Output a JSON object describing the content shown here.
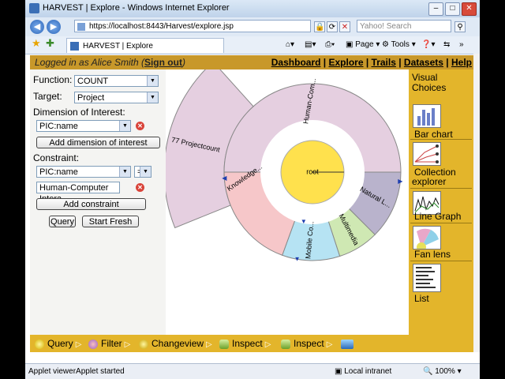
{
  "window": {
    "title": "HARVEST | Explore - Windows Internet Explorer"
  },
  "address_bar": {
    "url": "https://localhost:8443/Harvest/explore.jsp",
    "search_placeholder": "Yahoo! Search"
  },
  "tab": {
    "label": "HARVEST | Explore"
  },
  "ie_toolbar": {
    "page": "Page",
    "tools": "Tools"
  },
  "header": {
    "logged_prefix": "Logged in as Alice Smith (",
    "sign_out": "Sign out",
    "logged_suffix": ")",
    "links": [
      "Dashboard",
      "Explore",
      "Trails",
      "Datasets",
      "Help"
    ]
  },
  "form": {
    "function_label": "Function:",
    "function_value": "COUNT",
    "target_label": "Target:",
    "target_value": "Project",
    "dim_label": "Dimension of Interest:",
    "dim_value": "PIC:name",
    "add_dim": "Add dimension of interest",
    "constraint_label": "Constraint:",
    "constraint_field": "PIC:name",
    "constraint_op": "=",
    "constraint_value": "Human-Computer Intera",
    "add_constraint": "Add constraint",
    "query": "Query",
    "start_fresh": "Start Fresh"
  },
  "chart_data": {
    "type": "radial",
    "root": "root",
    "segments": [
      {
        "label": "Human-Com...",
        "color": "#e5cfe0"
      },
      {
        "label": "Natural L...",
        "color": "#b9b3cc"
      },
      {
        "label": "Multimedia",
        "color": "#cfe8b3"
      },
      {
        "label": "Mobile Co...",
        "color": "#b6e3f3"
      },
      {
        "label": "Knowledge...",
        "color": "#f6c7c9"
      }
    ],
    "outer": {
      "label": "77 Projectcount",
      "color": "#e5cfe0"
    }
  },
  "visual_choices": {
    "title_line1": "Visual",
    "title_line2": "Choices",
    "items": [
      {
        "label": "Bar chart",
        "icon": "bar-chart-icon"
      },
      {
        "label": "Collection",
        "label2": "explorer",
        "icon": "collection-explorer-icon"
      },
      {
        "label": "Line Graph",
        "icon": "line-graph-icon"
      },
      {
        "label": "Fan lens",
        "icon": "fan-lens-icon"
      },
      {
        "label": "List",
        "icon": "list-icon"
      }
    ]
  },
  "trail": [
    {
      "label": "Query",
      "icon": "query-icon"
    },
    {
      "label": "Filter",
      "icon": "filter-icon"
    },
    {
      "label": "Changeview",
      "icon": "changeview-icon"
    },
    {
      "label": "Inspect",
      "icon": "inspect-icon"
    },
    {
      "label": "Inspect",
      "icon": "inspect-icon"
    }
  ],
  "status": {
    "left": "Applet viewerApplet started",
    "zone": "Local intranet",
    "zoom": "100%"
  }
}
